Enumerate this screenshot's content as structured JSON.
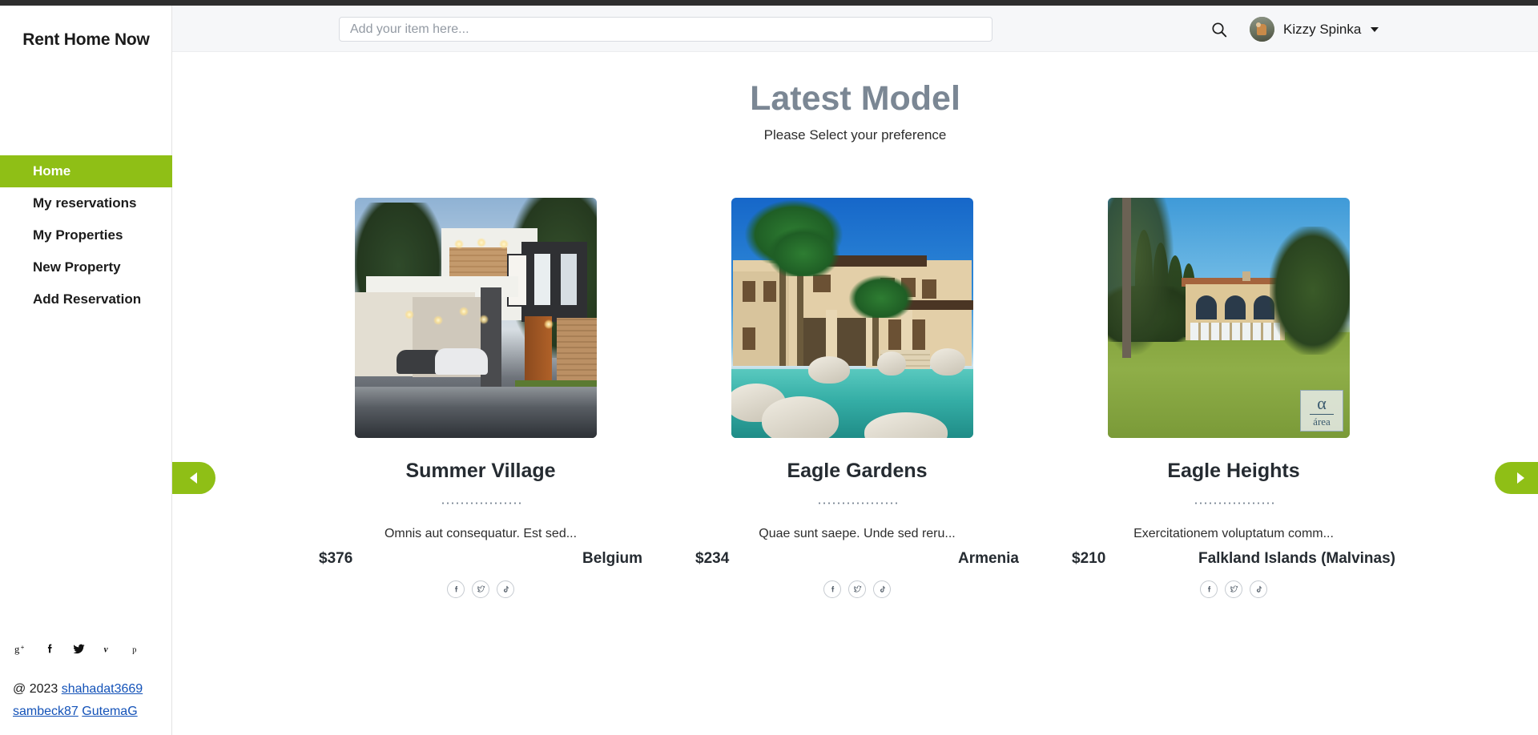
{
  "brand": {
    "name": "Rent Home Now"
  },
  "sidebar": {
    "items": [
      {
        "label": "Home",
        "active": true
      },
      {
        "label": "My reservations",
        "active": false
      },
      {
        "label": "My Properties",
        "active": false
      },
      {
        "label": "New Property",
        "active": false
      },
      {
        "label": "Add Reservation",
        "active": false
      }
    ],
    "active_color": "#8fbf16",
    "social": [
      {
        "icon": "google-plus-icon",
        "glyph": "g+"
      },
      {
        "icon": "facebook-icon",
        "glyph": "f"
      },
      {
        "icon": "twitter-icon",
        "glyph": "t"
      },
      {
        "icon": "vimeo-icon",
        "glyph": "v"
      },
      {
        "icon": "pinterest-icon",
        "glyph": "p"
      }
    ],
    "footer": {
      "copyright": "@ 2023",
      "links": [
        "shahadat3669",
        "sambeck87",
        "GutemaG"
      ]
    }
  },
  "header": {
    "search": {
      "placeholder": "Add your item here...",
      "value": ""
    },
    "search_icon": "search-icon",
    "user": {
      "name": "Kizzy Spinka",
      "caret_icon": "chevron-down-icon"
    }
  },
  "main": {
    "title": "Latest Model",
    "subtitle": "Please Select your preference",
    "prev_label": "◀",
    "next_label": "▶"
  },
  "cards": [
    {
      "title": "Summer Village",
      "description": "Omnis aut consequatur. Est sed...",
      "price": "$376",
      "location": "Belgium",
      "image_alt": "modern-house-at-dusk",
      "socials": [
        "facebook-icon",
        "twitter-icon",
        "tiktok-icon"
      ]
    },
    {
      "title": "Eagle Gardens",
      "description": "Quae sunt saepe. Unde sed reru...",
      "price": "$234",
      "location": "Armenia",
      "image_alt": "mediterranean-villa-with-pool",
      "socials": [
        "facebook-icon",
        "twitter-icon",
        "tiktok-icon"
      ]
    },
    {
      "title": "Eagle Heights",
      "description": "Exercitationem voluptatum comm...",
      "price": "$210",
      "location": "Falkland Islands (Malvinas)",
      "image_alt": "classical-villa-with-lawn",
      "watermark": {
        "symbol": "α",
        "text": "área"
      },
      "socials": [
        "facebook-icon",
        "twitter-icon",
        "tiktok-icon"
      ]
    }
  ]
}
